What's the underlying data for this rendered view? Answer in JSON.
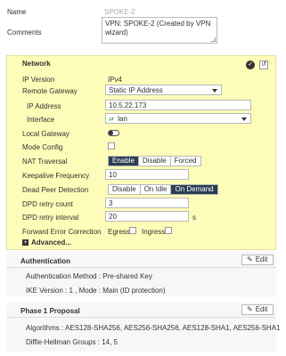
{
  "form": {
    "name_label": "Name",
    "name_value": "SPOKE-2",
    "comments_label": "Comments",
    "comments_value": "VPN: SPOKE-2 (Created by VPN wizard)"
  },
  "network": {
    "title": "Network",
    "ip_version_label": "IP Version",
    "ip_version_value": "IPv4",
    "remote_gateway_label": "Remote Gateway",
    "remote_gateway_value": "Static IP Address",
    "ip_address_label": "IP Address",
    "ip_address_value": "10.5.22.173",
    "interface_label": "Interface",
    "interface_value": "lan",
    "local_gateway_label": "Local Gateway",
    "mode_config_label": "Mode Config",
    "nat_traversal_label": "NAT Traversal",
    "nat_options": [
      "Enable",
      "Disable",
      "Forced"
    ],
    "nat_selected": "Enable",
    "keepalive_label": "Keepalive Frequency",
    "keepalive_value": "10",
    "dpd_label": "Dead Peer Detection",
    "dpd_options": [
      "Disable",
      "On Idle",
      "On Demand"
    ],
    "dpd_selected": "On Demand",
    "dpd_retry_count_label": "DPD retry count",
    "dpd_retry_count_value": "3",
    "dpd_retry_interval_label": "DPD retry interval",
    "dpd_retry_interval_value": "20",
    "dpd_retry_interval_unit": "s",
    "fec_label": "Forward Error Correction",
    "fec_egress_label": "Egress",
    "fec_ingress_label": "Ingress",
    "advanced_label": "Advanced..."
  },
  "authentication": {
    "title": "Authentication",
    "edit_label": "Edit",
    "method_text": "Authentication Method : Pre-shared Key",
    "ike_text": "IKE Version : 1 , Mode : Main (ID protection)"
  },
  "phase1": {
    "title": "Phase 1 Proposal",
    "edit_label": "Edit",
    "algorithms_text": "Algorithms : AES128-SHA256, AES256-SHA256, AES128-SHA1, AES256-SHA1",
    "dh_text": "Diffie-Hellman Groups : 14, 5"
  },
  "colors": {
    "network_bg": "#fdfcb8",
    "active_segment": "#2b3e53"
  }
}
